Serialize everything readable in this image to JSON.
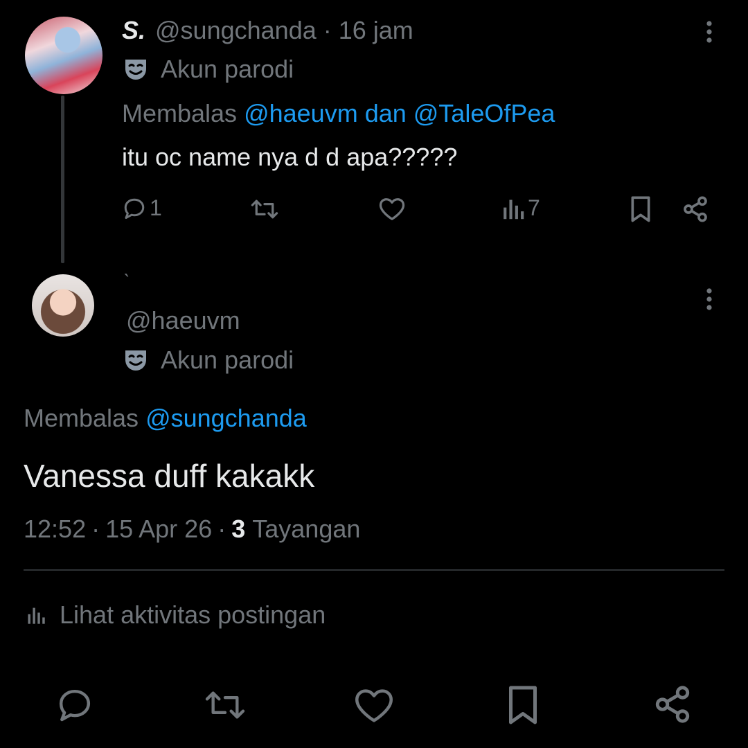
{
  "tweet1": {
    "display_name": "S.",
    "handle": "@sungchanda",
    "separator": "·",
    "time": "16 jam",
    "badge_label": "Akun parodi",
    "reply_prefix": "Membalas",
    "reply_user1": "@haeuvm",
    "reply_conj": "dan",
    "reply_user2": "@TaleOfPea",
    "text": "itu oc name nya d d apa?????",
    "reply_count": "1",
    "views_count": "7"
  },
  "tweet2": {
    "display_name": "˴",
    "handle": "@haeuvm",
    "badge_label": "Akun parodi",
    "reply_prefix": "Membalas",
    "reply_user": "@sungchanda",
    "text": "Vanessa duff kakakk",
    "time": "12:52",
    "sep1": "·",
    "date": "15 Apr 26",
    "sep2": "·",
    "views_count": "3",
    "views_label": "Tayangan",
    "activity_label": "Lihat aktivitas postingan"
  },
  "colors": {
    "background": "#000000",
    "text": "#e7e9ea",
    "muted": "#71767b",
    "link": "#1d9bf0"
  },
  "icons": [
    "more-vertical-icon",
    "parody-mask-icon",
    "reply-icon",
    "retweet-icon",
    "like-icon",
    "views-icon",
    "bookmark-icon",
    "share-icon"
  ]
}
